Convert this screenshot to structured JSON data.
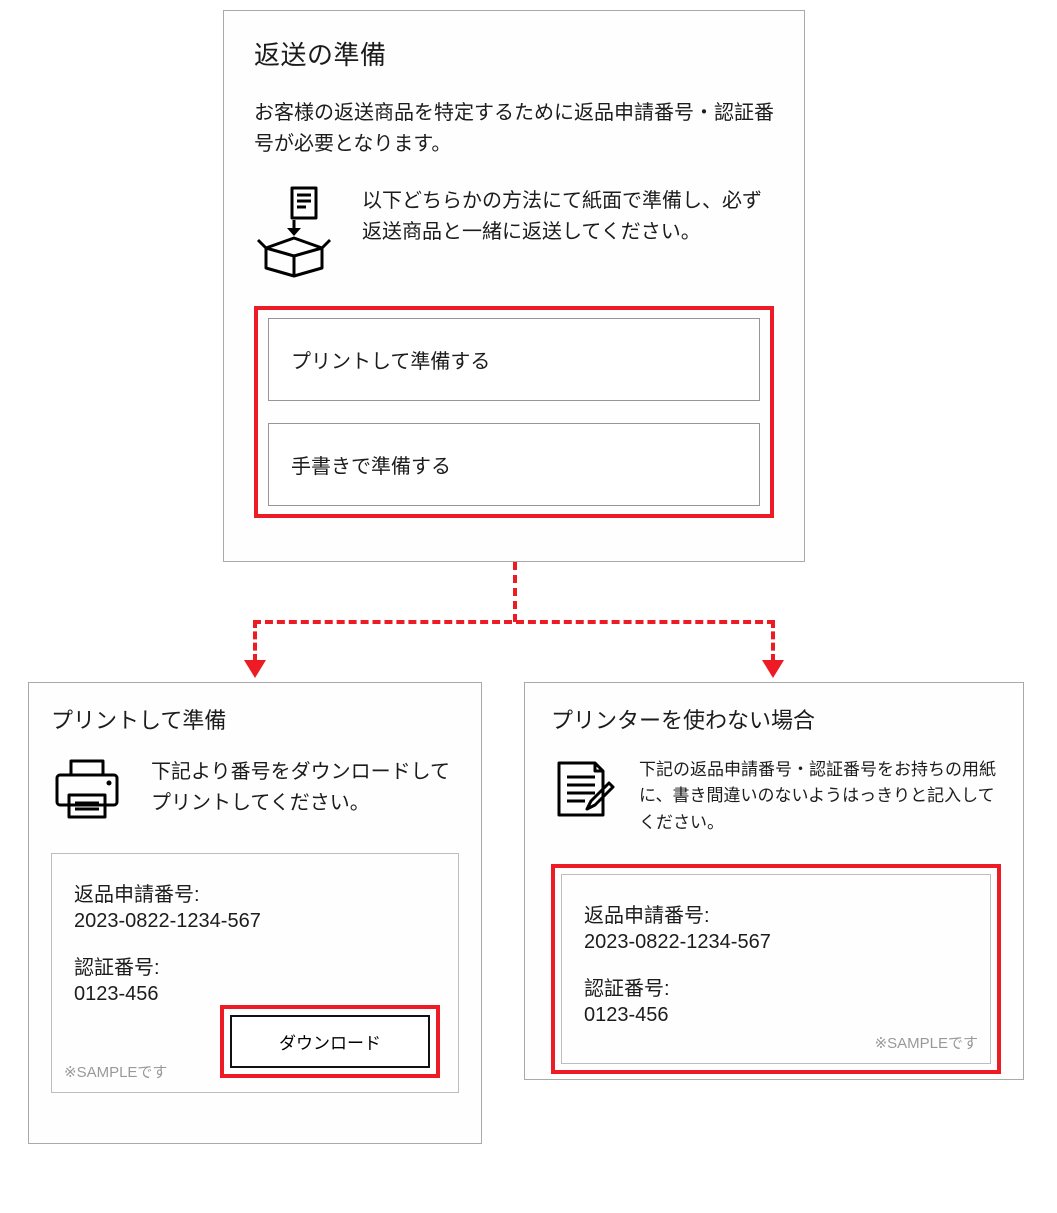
{
  "top": {
    "title": "返送の準備",
    "desc": "お客様の返送商品を特定するために返品申請番号・認証番号が必要となります。",
    "instruction": "以下どちらかの方法にて紙面で準備し、必ず返送商品と一緒に返送してください。",
    "option_print": "プリントして準備する",
    "option_write": "手書きで準備する"
  },
  "left": {
    "title": "プリントして準備",
    "desc": "下記より番号をダウンロードしてプリントしてください。",
    "req_label": "返品申請番号:",
    "req_value": "2023-0822-1234-567",
    "auth_label": "認証番号:",
    "auth_value": "0123-456",
    "download": "ダウンロード",
    "sample": "※SAMPLEです"
  },
  "right": {
    "title": "プリンターを使わない場合",
    "desc": "下記の返品申請番号・認証番号をお持ちの用紙に、書き間違いのないようはっきりと記入してください。",
    "req_label": "返品申請番号:",
    "req_value": "2023-0822-1234-567",
    "auth_label": "認証番号:",
    "auth_value": "0123-456",
    "sample": "※SAMPLEです"
  }
}
